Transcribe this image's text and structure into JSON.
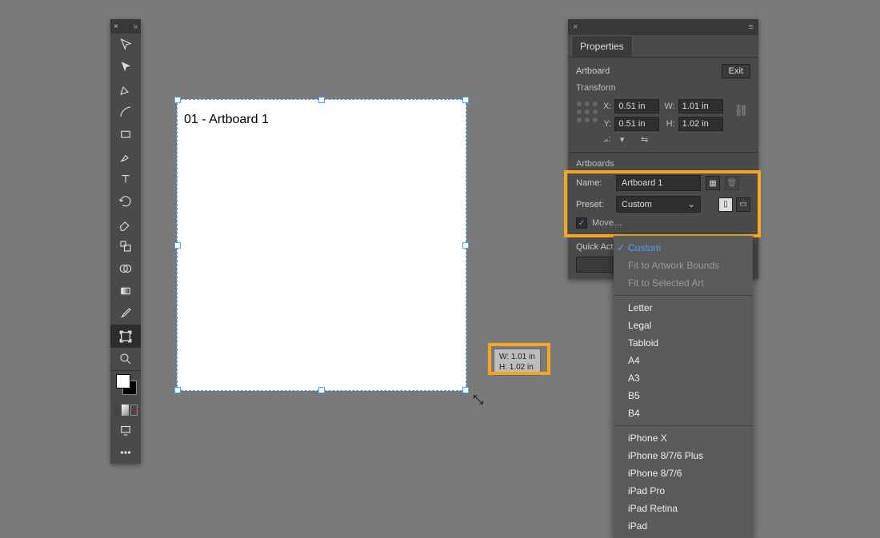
{
  "canvas": {
    "artboard_label": "01 - Artboard 1",
    "tooltip_w": "W: 1.01 in",
    "tooltip_h": "H: 1.02 in"
  },
  "panel": {
    "title": "Properties",
    "context": "Artboard",
    "exit": "Exit",
    "transform_label": "Transform",
    "x_label": "X:",
    "x_value": "0.51 in",
    "y_label": "Y:",
    "y_value": "0.51 in",
    "w_label": "W:",
    "w_value": "1.01 in",
    "h_label": "H:",
    "h_value": "1.02 in",
    "angle_label": "⦟:",
    "artboards_label": "Artboards",
    "name_label": "Name:",
    "name_value": "Artboard 1",
    "preset_label": "Preset:",
    "preset_value": "Custom",
    "move_label": "Move…",
    "quick_label": "Quick Act…"
  },
  "dropdown": {
    "items": [
      {
        "label": "Custom",
        "checked": true
      },
      {
        "label": "Fit to Artwork Bounds",
        "dim": true
      },
      {
        "label": "Fit to Selected Art",
        "dim": true
      },
      {
        "divider": true
      },
      {
        "label": "Letter"
      },
      {
        "label": "Legal"
      },
      {
        "label": "Tabloid"
      },
      {
        "label": "A4"
      },
      {
        "label": "A3"
      },
      {
        "label": "B5"
      },
      {
        "label": "B4"
      },
      {
        "divider": true
      },
      {
        "label": "iPhone X"
      },
      {
        "label": "iPhone 8/7/6 Plus"
      },
      {
        "label": "iPhone 8/7/6"
      },
      {
        "label": "iPad Pro"
      },
      {
        "label": "iPad Retina"
      },
      {
        "label": "iPad"
      }
    ]
  }
}
